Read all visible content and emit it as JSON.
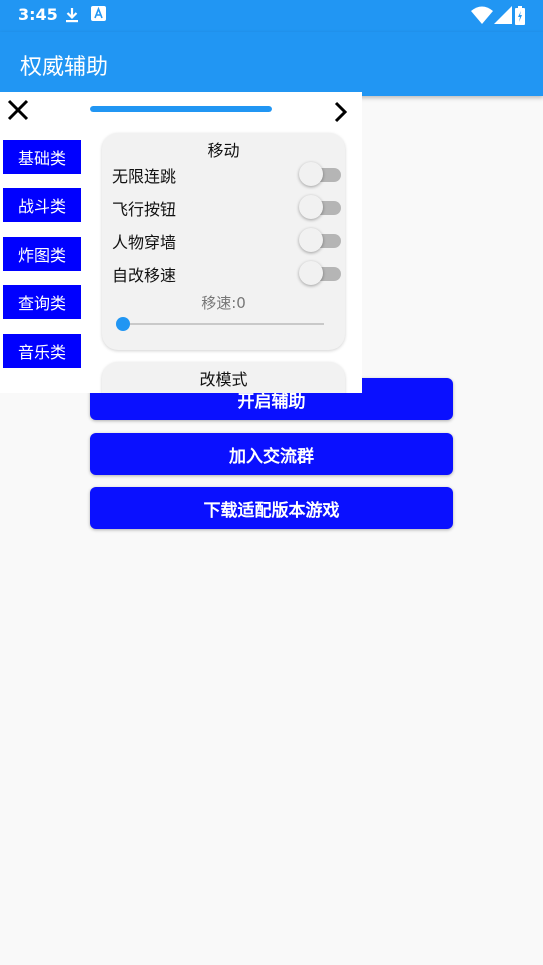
{
  "status_bar": {
    "time": "3:45",
    "icons": [
      "download-icon",
      "a-notification-icon",
      "wifi-icon",
      "signal-icon",
      "battery-icon"
    ],
    "color": "#2196f3"
  },
  "app_bar": {
    "title": "权威辅助",
    "color": "#2196f3"
  },
  "main_buttons": [
    {
      "label": "开启辅助"
    },
    {
      "label": "加入交流群"
    },
    {
      "label": "下载适配版本游戏"
    }
  ],
  "button_color": "#0a10ff",
  "panel": {
    "close_icon": "close-icon",
    "next_icon": "chevron-right-icon",
    "progress": 1.0,
    "categories": [
      {
        "label": "基础类"
      },
      {
        "label": "战斗类"
      },
      {
        "label": "炸图类"
      },
      {
        "label": "查询类"
      },
      {
        "label": "音乐类"
      }
    ],
    "move_card": {
      "title": "移动",
      "options": [
        {
          "label": "无限连跳",
          "on": false
        },
        {
          "label": "飞行按钮",
          "on": false
        },
        {
          "label": "人物穿墙",
          "on": false
        },
        {
          "label": "自改移速",
          "on": false
        }
      ],
      "speed_label": "移速:0",
      "speed_value": 0
    },
    "mode_card": {
      "title": "改模式"
    }
  }
}
